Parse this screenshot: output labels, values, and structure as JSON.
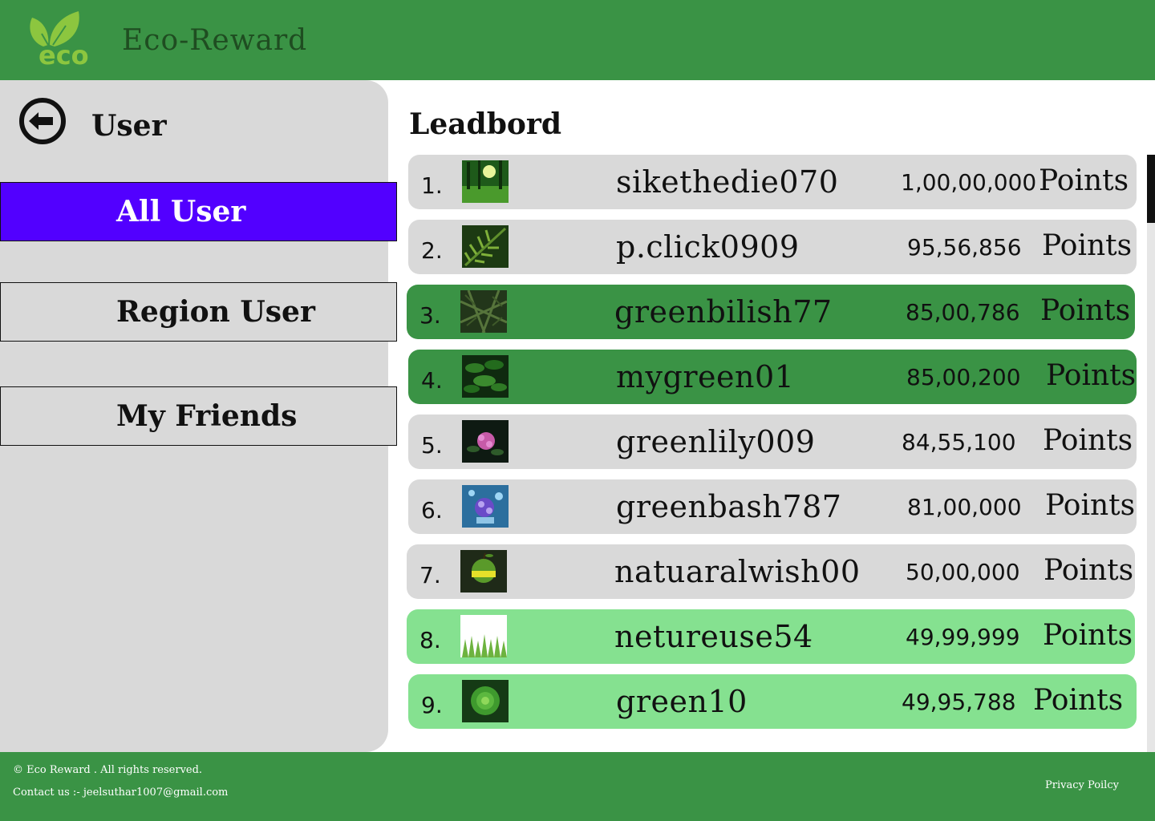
{
  "header": {
    "logo_text": "eco",
    "brand": "Eco-Reward"
  },
  "sidebar": {
    "title": "User",
    "items": [
      {
        "label": "All User",
        "active": true
      },
      {
        "label": "Region User",
        "active": false
      },
      {
        "label": "My Friends",
        "active": false
      }
    ]
  },
  "leaderboard": {
    "title": "Leadbord",
    "points_label": "Points",
    "rows": [
      {
        "rank": "1.",
        "username": "sikethedie070",
        "points": "1,00,00,000",
        "style": "gray",
        "thumb": "forest"
      },
      {
        "rank": "2.",
        "username": "p.click0909",
        "points": "95,56,856",
        "style": "gray",
        "thumb": "fern"
      },
      {
        "rank": "3.",
        "username": "greenbilish77",
        "points": "85,00,786",
        "style": "dark",
        "thumb": "fern-pattern"
      },
      {
        "rank": "4.",
        "username": "mygreen01",
        "points": "85,00,200",
        "style": "dark",
        "thumb": "leaves"
      },
      {
        "rank": "5.",
        "username": "greenlily009",
        "points": "84,55,100",
        "style": "gray",
        "thumb": "pink-flower"
      },
      {
        "rank": "6.",
        "username": "greenbash787",
        "points": "81,00,000",
        "style": "gray",
        "thumb": "blue-flower"
      },
      {
        "rank": "7.",
        "username": "natuaralwish00",
        "points": "50,00,000",
        "style": "gray",
        "thumb": "green-apple"
      },
      {
        "rank": "8.",
        "username": "netureuse54",
        "points": "49,99,999",
        "style": "light",
        "thumb": "grass"
      },
      {
        "rank": "9.",
        "username": "green10",
        "points": "49,95,788",
        "style": "light",
        "thumb": "succulent"
      }
    ]
  },
  "footer": {
    "copyright": "© Eco Reward . All rights reserved.",
    "contact": "Contact us :- jeelsuthar1007@gmail.com",
    "privacy": "Privacy Poilcy"
  },
  "colors": {
    "brand_green": "#3a9345",
    "light_green": "#85e190",
    "active_nav": "#5200ff",
    "panel_gray": "#d9d9d9"
  }
}
